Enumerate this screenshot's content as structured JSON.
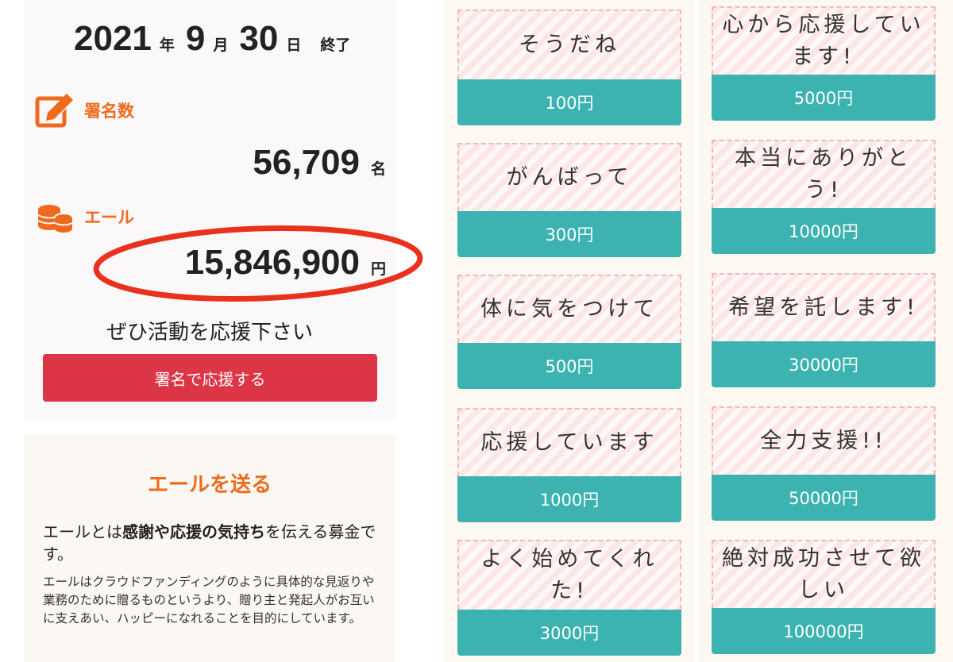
{
  "campaign": {
    "end_year": "2021",
    "year_unit": "年",
    "end_month": "9",
    "month_unit": "月",
    "end_day": "30",
    "day_unit": "日",
    "end_label": "終了"
  },
  "signatures": {
    "label": "署名数",
    "icon": "pencil-edit-icon",
    "count": "56,709",
    "unit": "名"
  },
  "ale_total": {
    "label": "エール",
    "icon": "coin-stack-icon",
    "amount": "15,846,900",
    "unit": "円"
  },
  "cta": {
    "support_text": "ぜひ活動を応援下さい",
    "sign_button_label": "署名で応援する"
  },
  "send_ale": {
    "title": "エールを送る",
    "desc_prefix": "エールとは",
    "desc_bold1": "感謝",
    "desc_mid": "や",
    "desc_bold2": "応援の気持ち",
    "desc_suffix": "を伝える募金です。",
    "desc_detail": "エールはクラウドファンディングのように具体的な見返りや業務のために贈るものというより、贈り主と発起人がお互いに支えあい、ハッピーになれることを目的にしています。"
  },
  "ale_options": [
    {
      "message": "そうだね",
      "amount": "100円"
    },
    {
      "message": "心から応援しています!",
      "amount": "5000円"
    },
    {
      "message": "がんばって",
      "amount": "300円"
    },
    {
      "message": "本当にありがとう!",
      "amount": "10000円"
    },
    {
      "message": "体に気をつけて",
      "amount": "500円"
    },
    {
      "message": "希望を託します!",
      "amount": "30000円"
    },
    {
      "message": "応援しています",
      "amount": "1000円"
    },
    {
      "message": "全力支援!!",
      "amount": "50000円"
    },
    {
      "message": "よく始めてくれた!",
      "amount": "3000円"
    },
    {
      "message": "絶対成功させて欲しい",
      "amount": "100000円"
    }
  ],
  "colors": {
    "accent_orange": "#ef6a1c",
    "button_red": "#dc3545",
    "amount_teal": "#3cb3b0",
    "highlight_ellipse": "#e8321e"
  }
}
